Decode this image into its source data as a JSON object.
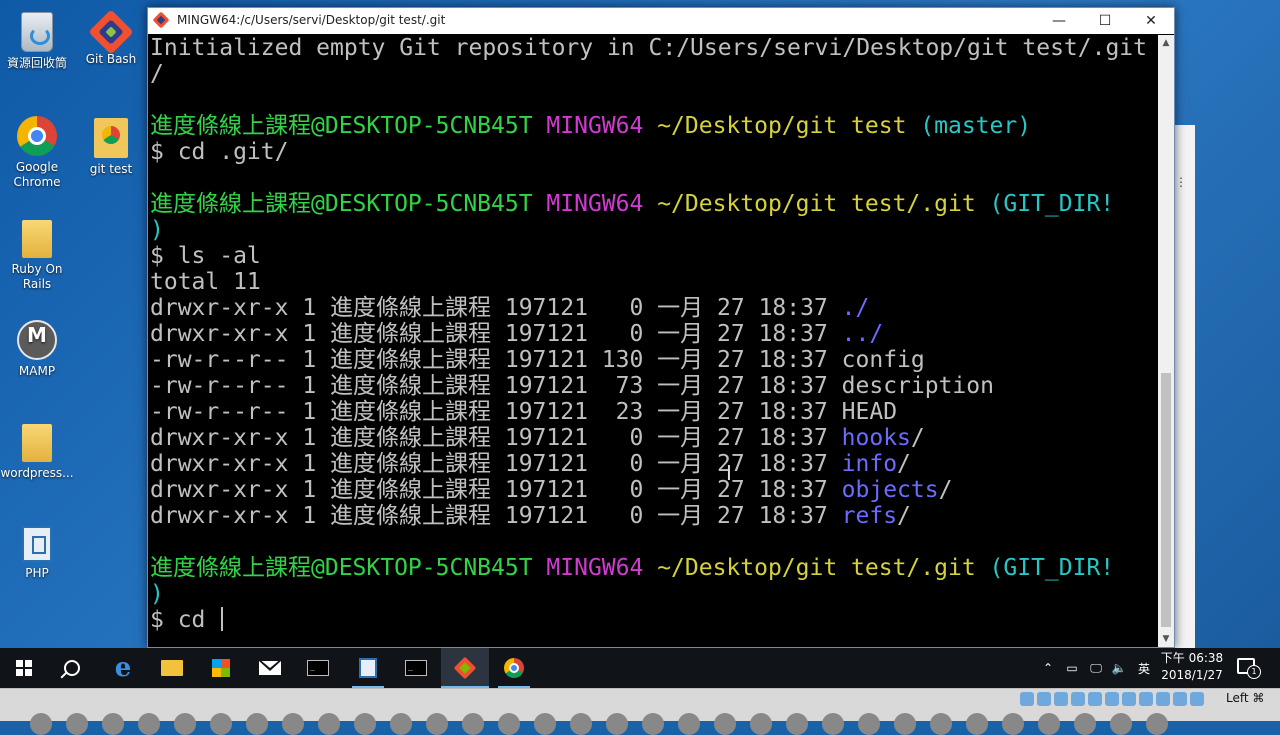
{
  "desktop": {
    "icons": [
      {
        "label": "資源回收筒",
        "icon": "recycle-bin-icon"
      },
      {
        "label": "Git Bash",
        "icon": "git-bash-icon"
      },
      {
        "label": "Google Chrome",
        "icon": "google-chrome-icon"
      },
      {
        "label": "git test",
        "icon": "chrome-shortcut-icon"
      },
      {
        "label": "Ruby On Rails",
        "icon": "folder-icon"
      },
      {
        "label": "MAMP",
        "icon": "mamp-icon"
      },
      {
        "label": "wordpress...",
        "icon": "folder-icon"
      },
      {
        "label": "PHP",
        "icon": "php-icon"
      }
    ]
  },
  "window": {
    "title": "MINGW64:/c/Users/servi/Desktop/git test/.git",
    "minimize": "—",
    "maximize": "☐",
    "close": "✕"
  },
  "terminal": {
    "lines": [
      {
        "segs": [
          {
            "t": "Initialized empty Git repository in C:/Users/servi/Desktop/git test/.git"
          }
        ]
      },
      {
        "segs": [
          {
            "t": "/"
          }
        ]
      },
      {
        "segs": [
          {
            "t": ""
          }
        ]
      },
      {
        "segs": [
          {
            "t": "進度條線上課程@DESKTOP-5CNB45T ",
            "c": "green"
          },
          {
            "t": "MINGW64 ",
            "c": "magenta"
          },
          {
            "t": "~/Desktop/git test ",
            "c": "yellow"
          },
          {
            "t": "(master)",
            "c": "cyan"
          }
        ]
      },
      {
        "segs": [
          {
            "t": "$ cd .git/"
          }
        ]
      },
      {
        "segs": [
          {
            "t": ""
          }
        ]
      },
      {
        "segs": [
          {
            "t": "進度條線上課程@DESKTOP-5CNB45T ",
            "c": "green"
          },
          {
            "t": "MINGW64 ",
            "c": "magenta"
          },
          {
            "t": "~/Desktop/git test/.git ",
            "c": "yellow"
          },
          {
            "t": "(GIT_DIR!",
            "c": "cyan"
          }
        ]
      },
      {
        "segs": [
          {
            "t": ")",
            "c": "cyan"
          }
        ]
      },
      {
        "segs": [
          {
            "t": "$ ls -al"
          }
        ]
      },
      {
        "segs": [
          {
            "t": "total 11"
          }
        ]
      },
      {
        "segs": [
          {
            "t": "drwxr-xr-x 1 進度條線上課程 197121   0 一月 27 18:37 "
          },
          {
            "t": "./",
            "c": "blue"
          }
        ]
      },
      {
        "segs": [
          {
            "t": "drwxr-xr-x 1 進度條線上課程 197121   0 一月 27 18:37 "
          },
          {
            "t": "../",
            "c": "blue"
          }
        ]
      },
      {
        "segs": [
          {
            "t": "-rw-r--r-- 1 進度條線上課程 197121 130 一月 27 18:37 config"
          }
        ]
      },
      {
        "segs": [
          {
            "t": "-rw-r--r-- 1 進度條線上課程 197121  73 一月 27 18:37 description"
          }
        ]
      },
      {
        "segs": [
          {
            "t": "-rw-r--r-- 1 進度條線上課程 197121  23 一月 27 18:37 HEAD"
          }
        ]
      },
      {
        "segs": [
          {
            "t": "drwxr-xr-x 1 進度條線上課程 197121   0 一月 27 18:37 "
          },
          {
            "t": "hooks",
            "c": "blue"
          },
          {
            "t": "/"
          }
        ]
      },
      {
        "segs": [
          {
            "t": "drwxr-xr-x 1 進度條線上課程 197121   0 一月 27 18:37 "
          },
          {
            "t": "info",
            "c": "blue"
          },
          {
            "t": "/"
          }
        ]
      },
      {
        "segs": [
          {
            "t": "drwxr-xr-x 1 進度條線上課程 197121   0 一月 27 18:37 "
          },
          {
            "t": "objects",
            "c": "blue"
          },
          {
            "t": "/"
          }
        ]
      },
      {
        "segs": [
          {
            "t": "drwxr-xr-x 1 進度條線上課程 197121   0 一月 27 18:37 "
          },
          {
            "t": "refs",
            "c": "blue"
          },
          {
            "t": "/"
          }
        ]
      },
      {
        "segs": [
          {
            "t": ""
          }
        ]
      },
      {
        "segs": [
          {
            "t": "進度條線上課程@DESKTOP-5CNB45T ",
            "c": "green"
          },
          {
            "t": "MINGW64 ",
            "c": "magenta"
          },
          {
            "t": "~/Desktop/git test/.git ",
            "c": "yellow"
          },
          {
            "t": "(GIT_DIR!",
            "c": "cyan"
          }
        ]
      },
      {
        "segs": [
          {
            "t": ")",
            "c": "cyan"
          }
        ]
      },
      {
        "segs": [
          {
            "t": "$ cd "
          }
        ],
        "cursor": true
      }
    ]
  },
  "taskbar": {
    "items": [
      {
        "name": "start-button",
        "icon": "windows-logo-icon"
      },
      {
        "name": "search-button",
        "icon": "search-icon"
      },
      {
        "name": "edge-button",
        "icon": "edge-icon"
      },
      {
        "name": "file-explorer-button",
        "icon": "folder-icon"
      },
      {
        "name": "store-button",
        "icon": "store-icon"
      },
      {
        "name": "mail-button",
        "icon": "mail-icon"
      },
      {
        "name": "terminal-button",
        "icon": "terminal-icon"
      },
      {
        "name": "php-button",
        "icon": "php-icon"
      },
      {
        "name": "terminal-button-2",
        "icon": "terminal-icon"
      },
      {
        "name": "git-bash-button",
        "icon": "git-bash-icon"
      },
      {
        "name": "chrome-button",
        "icon": "google-chrome-icon"
      }
    ],
    "tray": {
      "ime": "英",
      "time": "下午 06:38",
      "date": "2018/1/27"
    }
  },
  "status_strip": {
    "keyboard": "Left ⌘"
  },
  "colors": {
    "green": "#31d447",
    "magenta": "#d13bd1",
    "yellow": "#d6d33a",
    "cyan": "#28c7c7",
    "blue": "#6b6bff",
    "default": "#c0c0c0"
  }
}
